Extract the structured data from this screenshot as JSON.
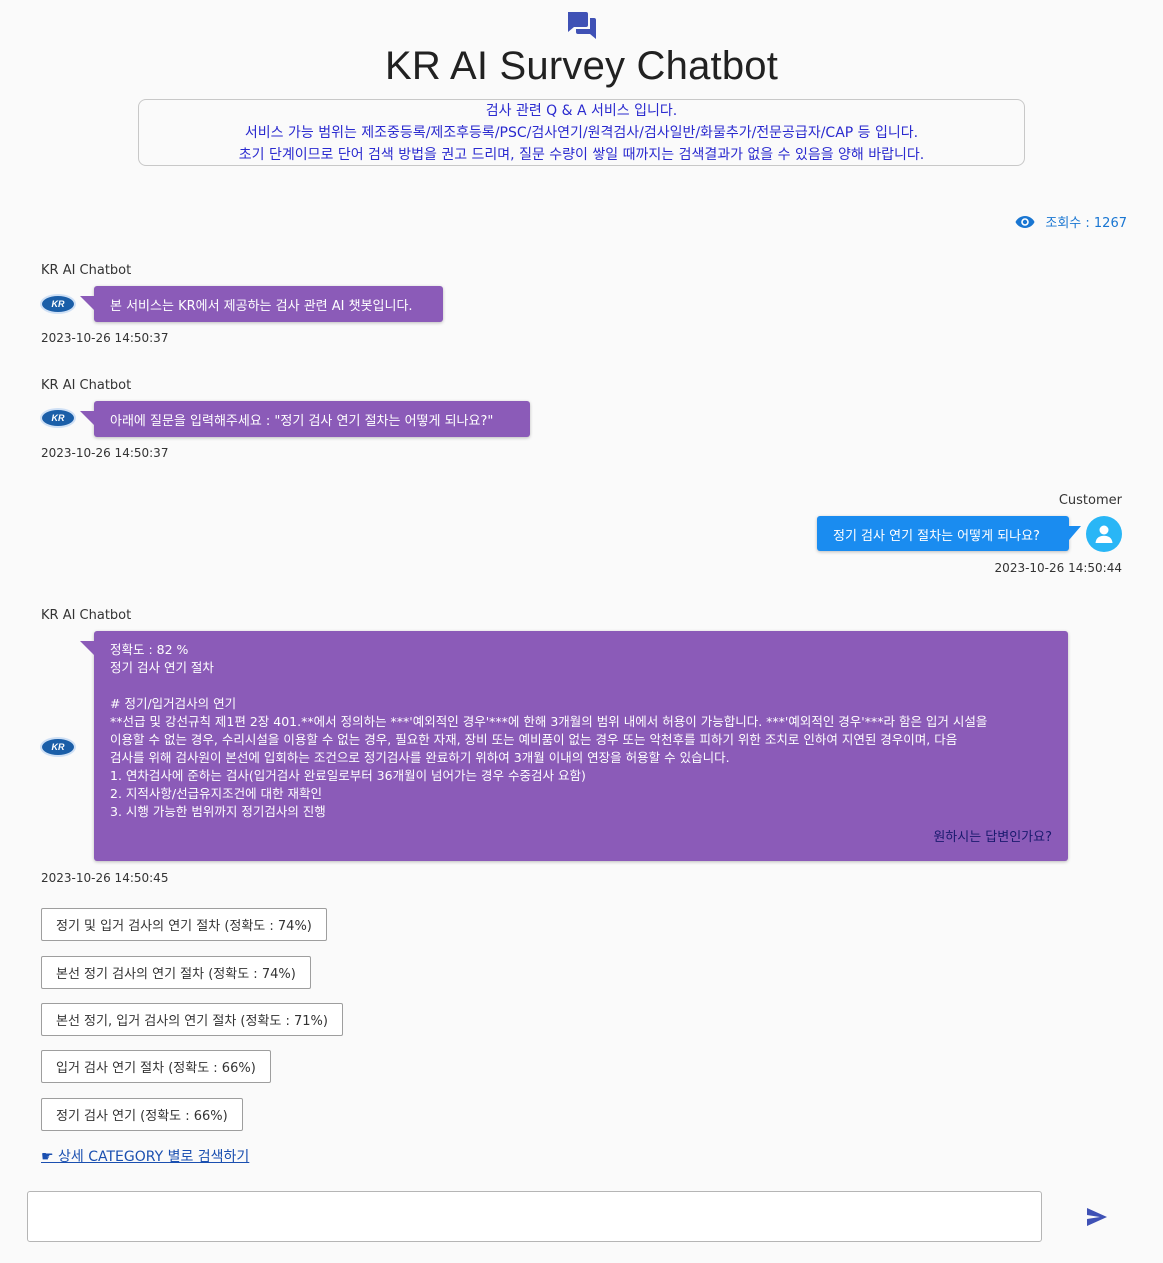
{
  "header": {
    "icon": "forum-icon",
    "title": "KR AI Survey Chatbot",
    "notice_lines": [
      "검사 관련 Q & A 서비스 입니다.",
      "서비스 가능 범위는 제조중등록/제조후등록/PSC/검사연기/원격검사/검사일반/화물추가/전문공급자/CAP 등 입니다.",
      "초기 단계이므로 단어 검색 방법을 권고 드리며, 질문 수량이 쌓일 때까지는 검색결과가 없을 수 있음을 양해 바랍니다."
    ]
  },
  "views": {
    "label": "조회수 : 1267",
    "icon": "eye-icon"
  },
  "bot_logo": "KR",
  "messages": [
    {
      "sender": "KR AI Chatbot",
      "text": "본 서비스는 KR에서 제공하는 검사 관련 AI 챗봇입니다.",
      "time": "2023-10-26 14:50:37"
    },
    {
      "sender": "KR AI Chatbot",
      "text": "아래에 질문을 입력해주세요 : \"정기 검사 연기 절차는 어떻게 되나요?\"",
      "time": "2023-10-26 14:50:37"
    },
    {
      "sender": "Customer",
      "text": "정기 검사 연기 절차는 어떻게 되나요?",
      "time": "2023-10-26 14:50:44"
    },
    {
      "sender": "KR AI Chatbot",
      "time": "2023-10-26 14:50:45",
      "lines": [
        "정확도 : 82 %",
        "정기 검사 연기 절차",
        "",
        "# 정기/입거검사의 연기",
        "**선급 및 강선규칙 제1편 2장 401.**에서 정의하는 ***'예외적인 경우'***에 한해 3개월의 범위 내에서 허용이 가능합니다. ***'예외적인 경우'***라 함은 입거 시설을",
        "이용할 수 없는 경우, 수리시설을 이용할 수 없는 경우, 필요한 자재, 장비 또는 예비품이 없는 경우 또는 악천후를 피하기 위한 조치로 인하여 지연된 경우이며, 다음",
        "검사를 위해 검사원이 본선에 입회하는 조건으로 정기검사를 완료하기 위하여 3개월 이내의 연장을 허용할 수 있습니다.",
        "1. 연차검사에 준하는 검사(입거검사 완료일로부터 36개월이 넘어가는 경우 수중검사 요함)",
        "2. 지적사항/선급유지조건에 대한 재확인",
        "3. 시행 가능한 범위까지 정기검사의 진행"
      ],
      "confirm": "원하시는 답변인가요?"
    }
  ],
  "suggestions": [
    "정기 및 입거 검사의 연기 절차 (정확도 : 74%)",
    "본선 정기 검사의 연기 절차 (정확도 : 74%)",
    "본선 정기, 입거 검사의 연기 절차 (정확도 : 71%)",
    "입거 검사 연기 절차 (정확도 : 66%)",
    "정기 검사 연기 (정확도 : 66%)"
  ],
  "category_link": "☛ 상세 CATEGORY 별로 검색하기",
  "input": {
    "value": "",
    "placeholder": ""
  },
  "send_icon": "send-icon",
  "colors": {
    "bot_bubble": "#8b5bb8",
    "user_bubble": "#1a8cf0",
    "notice_text": "#2a2acf",
    "accent": "#1976d2"
  }
}
